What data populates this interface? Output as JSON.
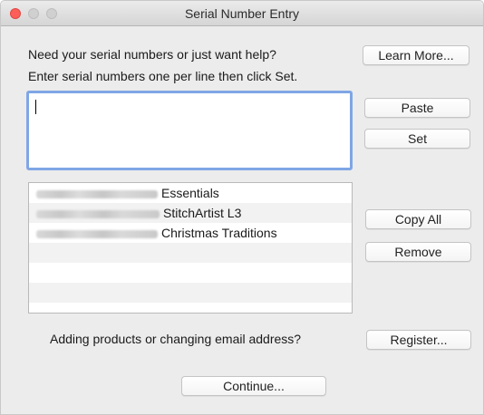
{
  "window": {
    "title": "Serial Number Entry"
  },
  "help": {
    "prompt": "Need your serial numbers or just want help?",
    "learn_more_label": "Learn More..."
  },
  "entry": {
    "instructions": "Enter serial numbers one per line then click Set.",
    "value": "",
    "paste_label": "Paste",
    "set_label": "Set"
  },
  "serials": {
    "rows": [
      {
        "serial": "",
        "product": "Essentials"
      },
      {
        "serial": "",
        "product": "StitchArtist L3"
      },
      {
        "serial": "",
        "product": "Christmas Traditions"
      },
      {
        "serial": "",
        "product": ""
      },
      {
        "serial": "",
        "product": ""
      },
      {
        "serial": "",
        "product": ""
      }
    ],
    "copy_all_label": "Copy All",
    "remove_label": "Remove"
  },
  "register": {
    "prompt": "Adding products or changing email address?",
    "button_label": "Register..."
  },
  "footer": {
    "continue_label": "Continue..."
  },
  "colors": {
    "focus_ring": "#7fa6e6",
    "close_button": "#fc5f57",
    "window_bg": "#ececec"
  }
}
